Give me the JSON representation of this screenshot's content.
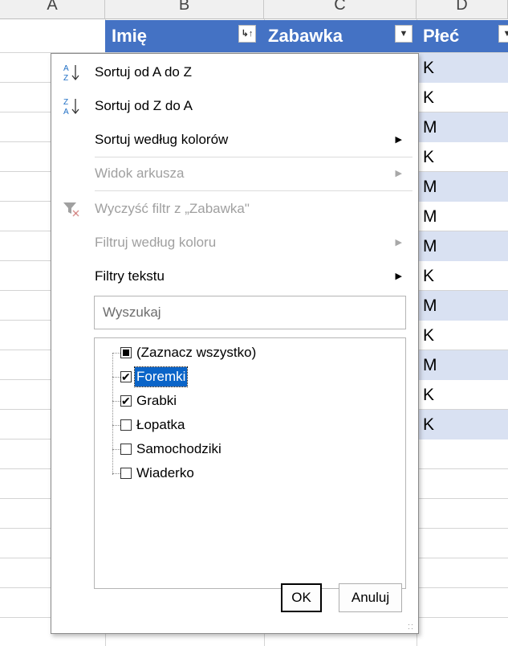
{
  "columns": [
    "A",
    "B",
    "C",
    "D"
  ],
  "headers": {
    "col_b": "Imię",
    "col_c": "Zabawka",
    "col_d": "Płeć"
  },
  "col_d_values": [
    "K",
    "K",
    "M",
    "K",
    "M",
    "M",
    "M",
    "K",
    "M",
    "K",
    "M",
    "K",
    "K"
  ],
  "menu": {
    "sort_az": "Sortuj od A do Z",
    "sort_za": "Sortuj od Z do A",
    "sort_by_color": "Sortuj według kolorów",
    "sheet_view": "Widok arkusza",
    "clear_filter": "Wyczyść filtr z „Zabawka\"",
    "filter_by_color": "Filtruj według koloru",
    "text_filters": "Filtry tekstu",
    "search_placeholder": "Wyszukaj",
    "items": [
      {
        "label": "(Zaznacz wszystko)",
        "state": "partial"
      },
      {
        "label": "Foremki",
        "state": "checked",
        "selected": true
      },
      {
        "label": "Grabki",
        "state": "checked"
      },
      {
        "label": "Łopatka",
        "state": "unchecked"
      },
      {
        "label": "Samochodziki",
        "state": "unchecked"
      },
      {
        "label": "Wiaderko",
        "state": "unchecked"
      }
    ],
    "ok": "OK",
    "cancel": "Anuluj"
  },
  "colors": {
    "header_fill": "#4472c4",
    "band_fill": "#d9e1f2",
    "selection": "#0a64c8"
  },
  "icons": [
    "sort-ascending-icon",
    "sort-descending-icon",
    "clear-filter-icon",
    "filter-sorted-icon",
    "dropdown-icon",
    "submenu-arrow-icon"
  ]
}
